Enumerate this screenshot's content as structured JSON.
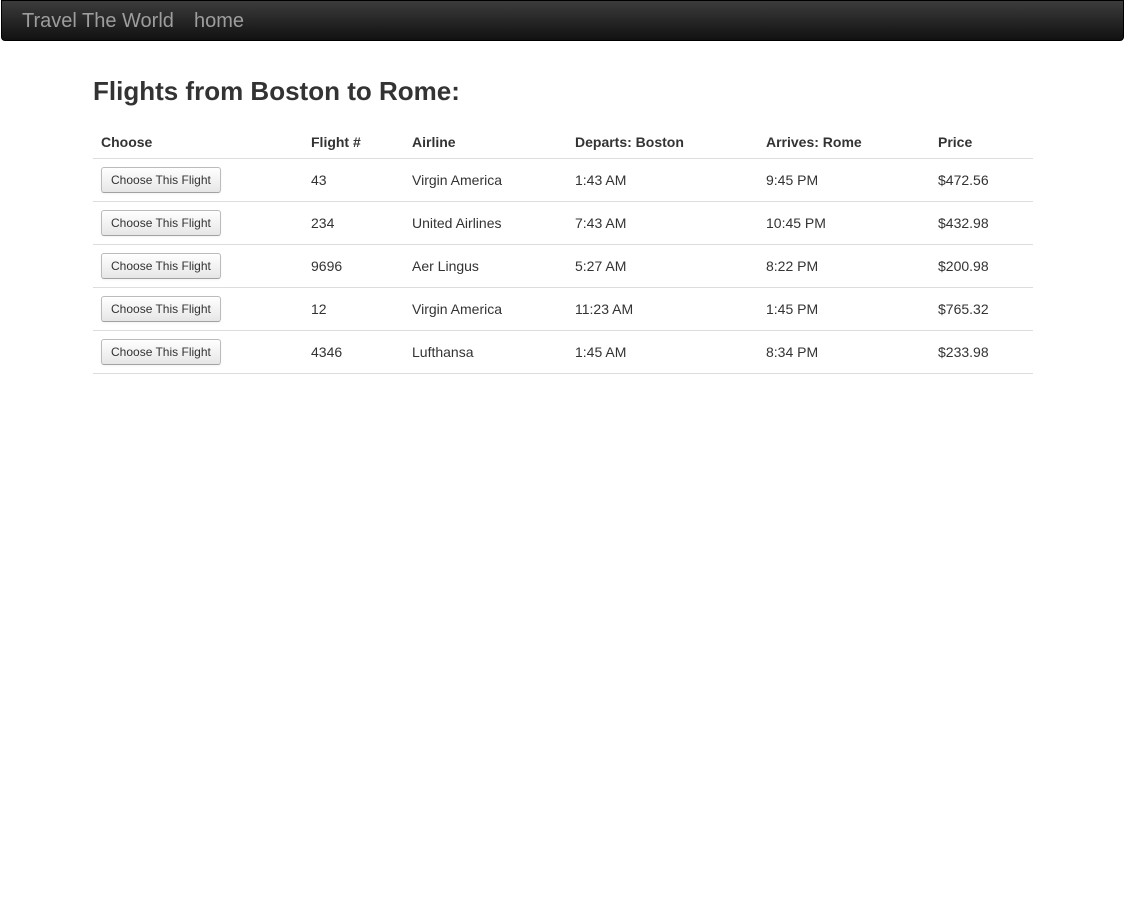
{
  "navbar": {
    "brand": "Travel The World",
    "home": "home"
  },
  "page": {
    "title": "Flights from Boston to Rome:"
  },
  "table": {
    "headers": [
      "Choose",
      "Flight #",
      "Airline",
      "Departs: Boston",
      "Arrives: Rome",
      "Price"
    ],
    "rows": [
      {
        "button": "Choose This Flight",
        "flight": "43",
        "airline": "Virgin America",
        "departs": "1:43 AM",
        "arrives": "9:45 PM",
        "price": "$472.56"
      },
      {
        "button": "Choose This Flight",
        "flight": "234",
        "airline": "United Airlines",
        "departs": "7:43 AM",
        "arrives": "10:45 PM",
        "price": "$432.98"
      },
      {
        "button": "Choose This Flight",
        "flight": "9696",
        "airline": "Aer Lingus",
        "departs": "5:27 AM",
        "arrives": "8:22 PM",
        "price": "$200.98"
      },
      {
        "button": "Choose This Flight",
        "flight": "12",
        "airline": "Virgin America",
        "departs": "11:23 AM",
        "arrives": "1:45 PM",
        "price": "$765.32"
      },
      {
        "button": "Choose This Flight",
        "flight": "4346",
        "airline": "Lufthansa",
        "departs": "1:45 AM",
        "arrives": "8:34 PM",
        "price": "$233.98"
      }
    ]
  }
}
